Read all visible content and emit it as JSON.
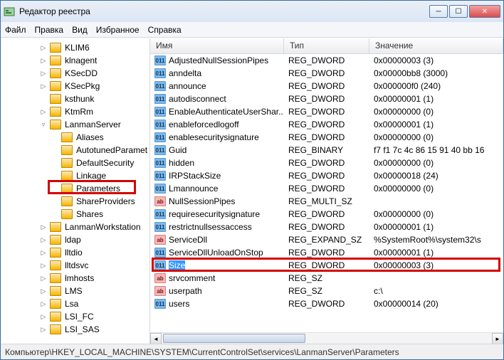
{
  "window": {
    "title": "Редактор реестра"
  },
  "menu": {
    "file": "Файл",
    "edit": "Правка",
    "view": "Вид",
    "favorites": "Избранное",
    "help": "Справка"
  },
  "columns": {
    "name": "Имя",
    "type": "Тип",
    "value": "Значение"
  },
  "tree": [
    {
      "depth": 3,
      "expand": "▷",
      "label": "KLIM6"
    },
    {
      "depth": 3,
      "expand": "▷",
      "label": "klnagent"
    },
    {
      "depth": 3,
      "expand": "▷",
      "label": "KSecDD"
    },
    {
      "depth": 3,
      "expand": "▷",
      "label": "KSecPkg"
    },
    {
      "depth": 3,
      "expand": "",
      "label": "ksthunk"
    },
    {
      "depth": 3,
      "expand": "▷",
      "label": "KtmRm"
    },
    {
      "depth": 3,
      "expand": "▿",
      "label": "LanmanServer"
    },
    {
      "depth": 4,
      "expand": "",
      "label": "Aliases"
    },
    {
      "depth": 4,
      "expand": "",
      "label": "AutotunedParamet"
    },
    {
      "depth": 4,
      "expand": "",
      "label": "DefaultSecurity"
    },
    {
      "depth": 4,
      "expand": "",
      "label": "Linkage"
    },
    {
      "depth": 4,
      "expand": "",
      "label": "Parameters",
      "hl": true
    },
    {
      "depth": 4,
      "expand": "",
      "label": "ShareProviders"
    },
    {
      "depth": 4,
      "expand": "",
      "label": "Shares"
    },
    {
      "depth": 3,
      "expand": "▷",
      "label": "LanmanWorkstation"
    },
    {
      "depth": 3,
      "expand": "▷",
      "label": "ldap"
    },
    {
      "depth": 3,
      "expand": "▷",
      "label": "lltdio"
    },
    {
      "depth": 3,
      "expand": "▷",
      "label": "lltdsvc"
    },
    {
      "depth": 3,
      "expand": "▷",
      "label": "lmhosts"
    },
    {
      "depth": 3,
      "expand": "▷",
      "label": "LMS"
    },
    {
      "depth": 3,
      "expand": "▷",
      "label": "Lsa"
    },
    {
      "depth": 3,
      "expand": "▷",
      "label": "LSI_FC"
    },
    {
      "depth": 3,
      "expand": "▷",
      "label": "LSI_SAS"
    }
  ],
  "values": [
    {
      "icon": "bin",
      "name": "AdjustedNullSessionPipes",
      "type": "REG_DWORD",
      "value": "0x00000003 (3)"
    },
    {
      "icon": "bin",
      "name": "anndelta",
      "type": "REG_DWORD",
      "value": "0x00000bb8 (3000)"
    },
    {
      "icon": "bin",
      "name": "announce",
      "type": "REG_DWORD",
      "value": "0x000000f0 (240)"
    },
    {
      "icon": "bin",
      "name": "autodisconnect",
      "type": "REG_DWORD",
      "value": "0x00000001 (1)"
    },
    {
      "icon": "bin",
      "name": "EnableAuthenticateUserShar...",
      "type": "REG_DWORD",
      "value": "0x00000000 (0)"
    },
    {
      "icon": "bin",
      "name": "enableforcedlogoff",
      "type": "REG_DWORD",
      "value": "0x00000001 (1)"
    },
    {
      "icon": "bin",
      "name": "enablesecuritysignature",
      "type": "REG_DWORD",
      "value": "0x00000000 (0)"
    },
    {
      "icon": "bin",
      "name": "Guid",
      "type": "REG_BINARY",
      "value": "f7 f1 7c 4c 86 15 91 40 bb 16"
    },
    {
      "icon": "bin",
      "name": "hidden",
      "type": "REG_DWORD",
      "value": "0x00000000 (0)"
    },
    {
      "icon": "bin",
      "name": "IRPStackSize",
      "type": "REG_DWORD",
      "value": "0x00000018 (24)"
    },
    {
      "icon": "bin",
      "name": "Lmannounce",
      "type": "REG_DWORD",
      "value": "0x00000000 (0)"
    },
    {
      "icon": "str",
      "name": "NullSessionPipes",
      "type": "REG_MULTI_SZ",
      "value": ""
    },
    {
      "icon": "bin",
      "name": "requiresecuritysignature",
      "type": "REG_DWORD",
      "value": "0x00000000 (0)"
    },
    {
      "icon": "bin",
      "name": "restrictnullsessaccess",
      "type": "REG_DWORD",
      "value": "0x00000001 (1)"
    },
    {
      "icon": "str",
      "name": "ServiceDll",
      "type": "REG_EXPAND_SZ",
      "value": "%SystemRoot%\\system32\\s"
    },
    {
      "icon": "bin",
      "name": "ServiceDllUnloadOnStop",
      "type": "REG_DWORD",
      "value": "0x00000001 (1)"
    },
    {
      "icon": "bin",
      "name": "Size",
      "type": "REG_DWORD",
      "value": "0x00000003 (3)",
      "selected": true,
      "hl": true
    },
    {
      "icon": "str",
      "name": "srvcomment",
      "type": "REG_SZ",
      "value": ""
    },
    {
      "icon": "str",
      "name": "userpath",
      "type": "REG_SZ",
      "value": "c:\\"
    },
    {
      "icon": "bin",
      "name": "users",
      "type": "REG_DWORD",
      "value": "0x00000014 (20)"
    }
  ],
  "status": {
    "path": "Компьютер\\HKEY_LOCAL_MACHINE\\SYSTEM\\CurrentControlSet\\services\\LanmanServer\\Parameters"
  },
  "icons": {
    "bin_text": "011",
    "str_text": "ab"
  }
}
